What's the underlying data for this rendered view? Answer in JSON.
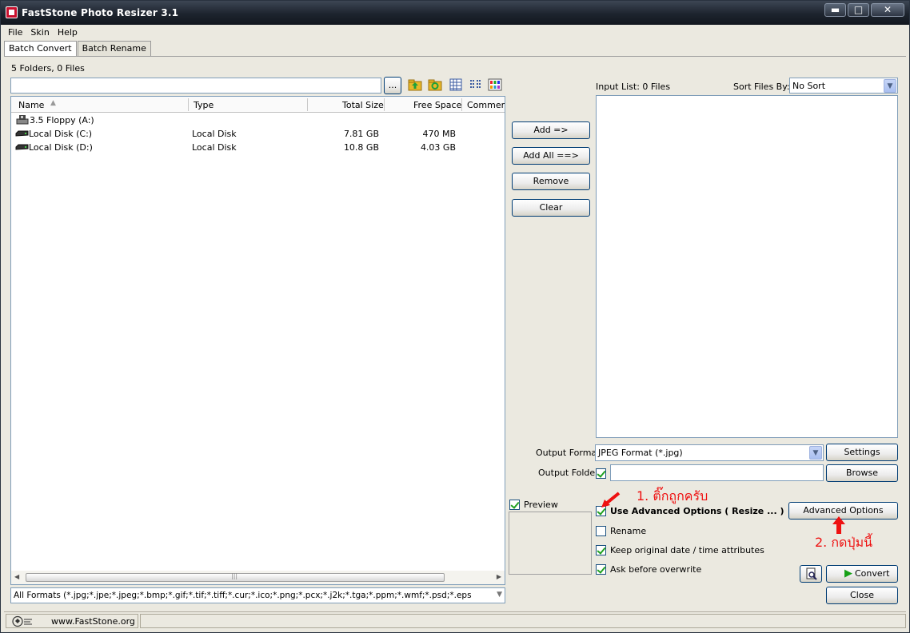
{
  "window": {
    "title": "FastStone Photo Resizer 3.1",
    "min_symbol": "▬",
    "max_symbol": "□",
    "close_symbol": "✕"
  },
  "menu": [
    "File",
    "Skin",
    "Help"
  ],
  "tabs": [
    "Batch Convert",
    "Batch Rename"
  ],
  "browser": {
    "summary": "5 Folders, 0 Files",
    "path_value": "",
    "browse_label": "...",
    "columns": [
      "Name",
      "Type",
      "Total Size",
      "Free Space",
      "Comments"
    ],
    "rows": [
      {
        "name": "3.5 Floppy (A:)",
        "type": "",
        "total": "",
        "free": "",
        "icon": "floppy-icon"
      },
      {
        "name": "Local Disk (C:)",
        "type": "Local Disk",
        "total": "7.81 GB",
        "free": "470 MB",
        "icon": "disk-icon"
      },
      {
        "name": "Local Disk (D:)",
        "type": "Local Disk",
        "total": "10.8 GB",
        "free": "4.03 GB",
        "icon": "disk-icon"
      }
    ],
    "filter": "All Formats (*.jpg;*.jpe;*.jpeg;*.bmp;*.gif;*.tif;*.tiff;*.cur;*.ico;*.png;*.pcx;*.j2k;*.tga;*.ppm;*.wmf;*.psd;*.eps"
  },
  "actions": {
    "add": "Add =>",
    "add_all": "Add All ==>",
    "remove": "Remove",
    "clear": "Clear"
  },
  "input_list": {
    "label": "Input List:  0 Files",
    "sort_label": "Sort Files By:",
    "sort_value": "No Sort"
  },
  "output": {
    "format_label": "Output Format:",
    "format_value": "JPEG Format (*.jpg)",
    "settings": "Settings",
    "folder_label": "Output Folder:",
    "folder_value": "",
    "browse": "Browse"
  },
  "options": {
    "preview": "Preview",
    "use_advanced": "Use Advanced Options ( Resize ... )",
    "rename": "Rename",
    "keep_date": "Keep original date / time attributes",
    "ask_overwrite": "Ask before overwrite",
    "advanced_button": "Advanced Options",
    "convert": "Convert",
    "close": "Close",
    "checked": {
      "preview": true,
      "use_advanced": true,
      "rename": false,
      "keep_date": true,
      "ask_overwrite": true,
      "output_folder": true
    }
  },
  "annotations": {
    "step1": "1. ติ๊กถูกครับ",
    "step2": "2. กดปุ่มนี้",
    "color": "#ee1111"
  },
  "status": {
    "url": "www.FastStone.org"
  },
  "colors": {
    "titlebar": "#1d242e",
    "face": "#ebe9e0",
    "button_border": "#003c74",
    "field_border": "#7f9db9"
  }
}
